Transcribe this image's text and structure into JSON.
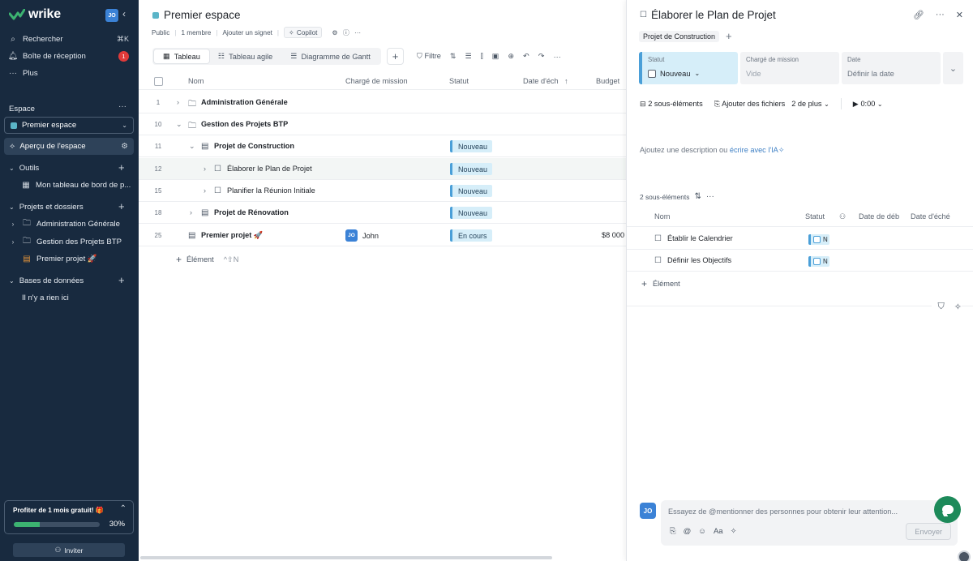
{
  "sidebar": {
    "logo_text": "wrike",
    "avatar": "JO",
    "nav": [
      {
        "label": "Rechercher",
        "icon": "search-icon",
        "shortcut": "⌘K"
      },
      {
        "label": "Boîte de réception",
        "icon": "bell-icon",
        "badge": "1"
      },
      {
        "label": "Plus",
        "icon": "more-icon"
      }
    ],
    "space_section_label": "Espace",
    "space_selected": "Premier espace",
    "overview_label": "Aperçu de l'espace",
    "tools_label": "Outils",
    "tools_items": [
      "Mon tableau de bord de p..."
    ],
    "projects_label": "Projets et dossiers",
    "projects_items": [
      "Administration Générale",
      "Gestion des Projets BTP",
      "Premier projet 🚀"
    ],
    "databases_label": "Bases de données",
    "databases_empty": "Il n'y a rien ici",
    "promo": {
      "title": "Profiter de 1 mois gratuit! 🎁",
      "progress_label": "30%",
      "progress": 0.3
    },
    "invite_label": "Inviter"
  },
  "main": {
    "title": "Premier espace",
    "meta": {
      "visibility": "Public",
      "members": "1 membre",
      "bookmark": "Ajouter un signet",
      "copilot": "Copilot"
    },
    "view_tabs": [
      "Tableau",
      "Tableau agile",
      "Diagramme de Gantt"
    ],
    "filter_label": "Filtre",
    "columns": {
      "name": "Nom",
      "assignee": "Chargé de mission",
      "status": "Statut",
      "due": "Date d'éch",
      "budget": "Budget"
    },
    "rows": [
      {
        "num": "1",
        "name": "Administration Générale",
        "status": "",
        "assignee": "",
        "budget": ""
      },
      {
        "num": "10",
        "name": "Gestion des Projets BTP",
        "status": "",
        "assignee": "",
        "budget": ""
      },
      {
        "num": "11",
        "name": "Projet de Construction",
        "status": "Nouveau",
        "assignee": "",
        "budget": ""
      },
      {
        "num": "12",
        "name": "Élaborer le Plan de Projet",
        "status": "Nouveau",
        "assignee": "",
        "budget": ""
      },
      {
        "num": "15",
        "name": "Planifier la Réunion Initiale",
        "status": "Nouveau",
        "assignee": "",
        "budget": ""
      },
      {
        "num": "18",
        "name": "Projet de Rénovation",
        "status": "Nouveau",
        "assignee": "",
        "budget": ""
      },
      {
        "num": "25",
        "name": "Premier projet 🚀",
        "status": "En cours",
        "assignee": "John",
        "assignee_initials": "JO",
        "budget": "$8 000"
      }
    ],
    "add_item_label": "Élément",
    "add_item_shortcut": "^⇧N"
  },
  "panel": {
    "title": "Élaborer le Plan de Projet",
    "parent_tag": "Projet de Construction",
    "fields": {
      "status_label": "Statut",
      "status_value": "Nouveau",
      "assignee_label": "Chargé de mission",
      "assignee_value": "Vide",
      "date_label": "Date",
      "date_value": "Définir la date"
    },
    "toolbar": {
      "subitems": "2 sous-éléments",
      "attach": "Ajouter des fichiers",
      "more": "2 de plus",
      "timer": "0:00"
    },
    "description_prefix": "Ajoutez une description ou ",
    "description_link": "écrire avec l'IA",
    "subitems_header": "2 sous-éléments",
    "sub_columns": {
      "name": "Nom",
      "status": "Statut",
      "start": "Date de déb",
      "due": "Date d'éché"
    },
    "subitems": [
      {
        "name": "Établir le Calendrier",
        "status": "N"
      },
      {
        "name": "Définir les Objectifs",
        "status": "N"
      }
    ],
    "add_item_label": "Élément",
    "comment": {
      "avatar": "JO",
      "placeholder": "Essayez de @mentionner des personnes pour obtenir leur attention...",
      "send_label": "Envoyer"
    }
  },
  "colors": {
    "sidebar_bg": "#182a3f",
    "status_new": "#d6eef9",
    "accent_blue": "#4a9fd8",
    "brand_green": "#3cb371"
  }
}
